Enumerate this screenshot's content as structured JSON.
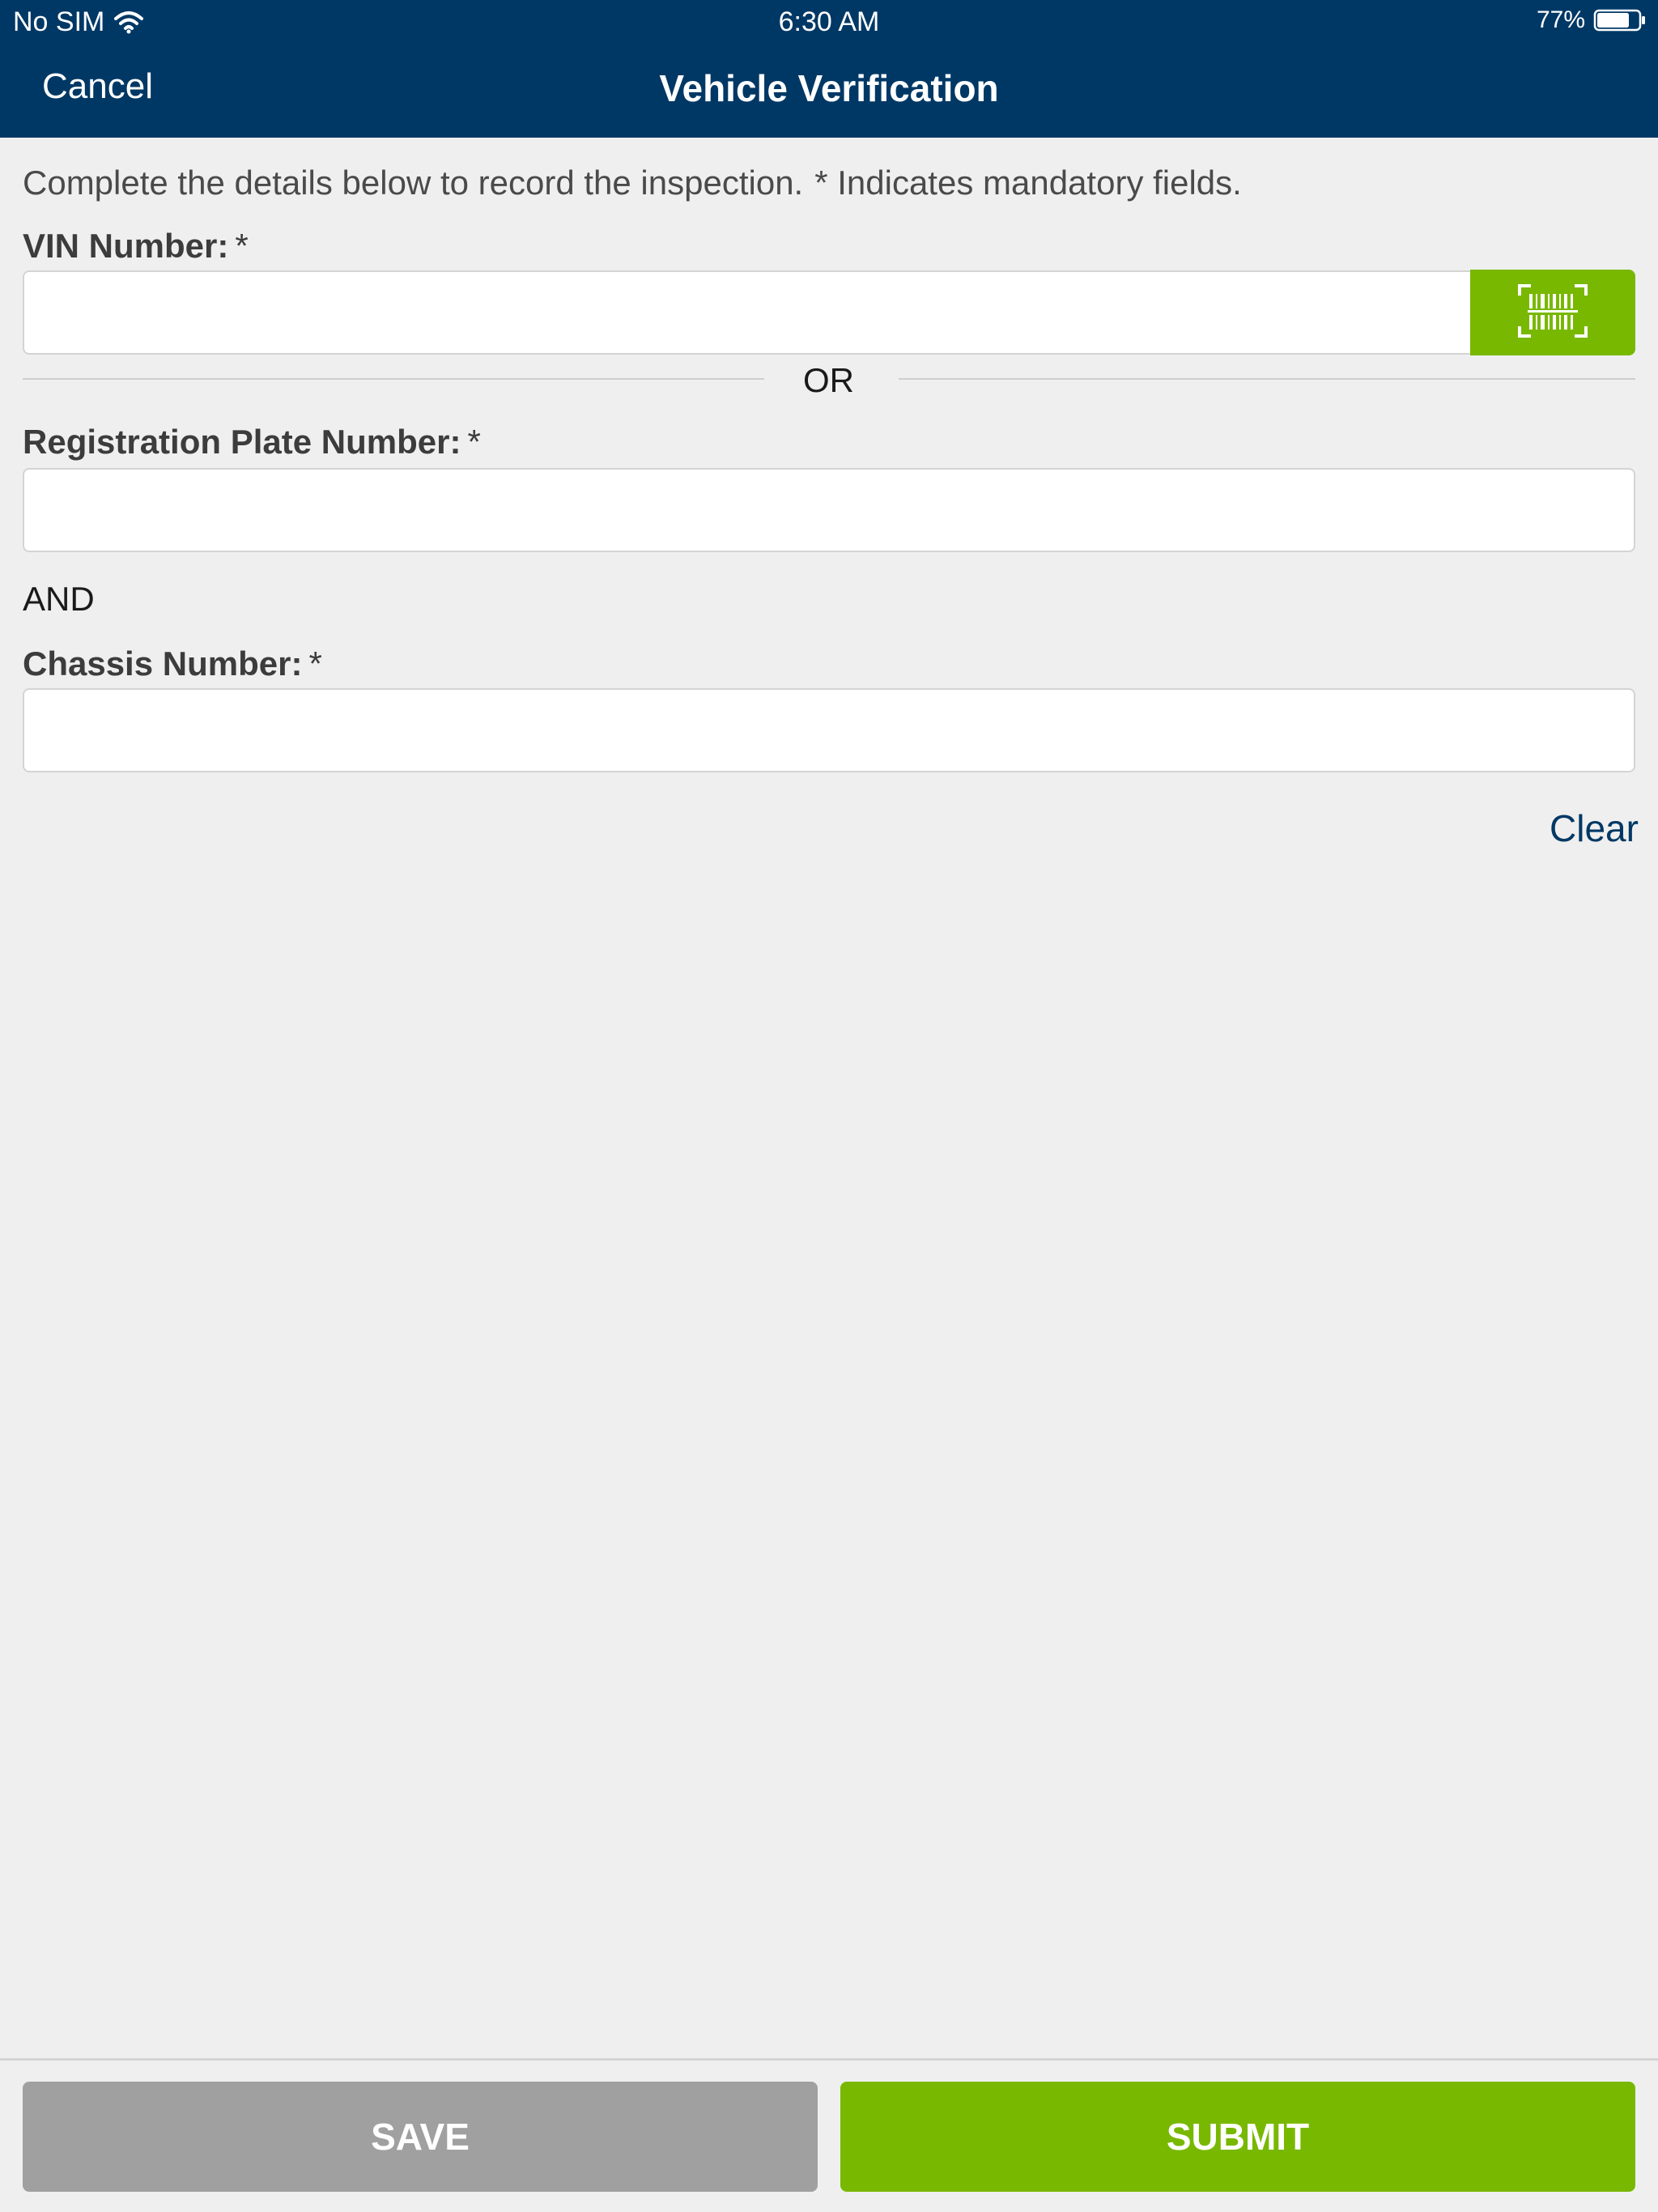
{
  "status_bar": {
    "carrier": "No SIM",
    "time": "6:30 AM",
    "battery": "77%",
    "battery_level": 0.77,
    "wifi_icon": "wifi-icon",
    "battery_icon": "battery-icon"
  },
  "nav": {
    "cancel_label": "Cancel",
    "title": "Vehicle Verification"
  },
  "form": {
    "intro": "Complete the details below to record the inspection.",
    "mandatory_note": "* Indicates mandatory fields.",
    "vin": {
      "label": "VIN Number:",
      "required_mark": "*",
      "value": "",
      "scan_icon": "barcode-scan-icon"
    },
    "or_label": "OR",
    "registration": {
      "label": "Registration Plate Number:",
      "required_mark": "*",
      "value": ""
    },
    "and_label": "AND",
    "chassis": {
      "label": "Chassis Number:",
      "required_mark": "*",
      "value": ""
    },
    "clear_label": "Clear"
  },
  "actions": {
    "save_label": "SAVE",
    "submit_label": "SUBMIT"
  },
  "colors": {
    "header_bg": "#003865",
    "accent_green": "#78b800",
    "save_gray": "#a0a0a0",
    "page_bg": "#efefef"
  }
}
